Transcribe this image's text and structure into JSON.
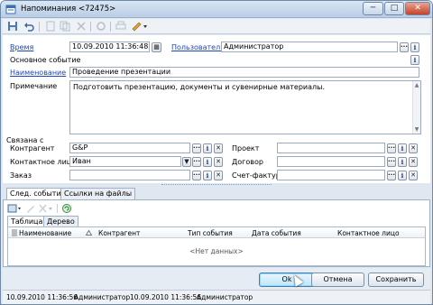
{
  "window": {
    "title": "Напоминания <72475>",
    "min": "─",
    "max": "□",
    "close": "✕"
  },
  "toolbar": {
    "icons": [
      "save-icon",
      "undo-icon",
      "new-icon",
      "copy-icon",
      "delete-icon",
      "refresh-icon",
      "print-icon",
      "actions-icon"
    ]
  },
  "form": {
    "time_label": "Время",
    "time_value": "10.09.2010 11:36:48",
    "user_label": "Пользователь",
    "user_value": "Администратор",
    "base_event_label": "Основное событие",
    "name_label": "Наименование",
    "name_value": "Проведение презентации",
    "note_label": "Примечание",
    "note_value": "Подготовить презентацию, документы и сувенирные материалы.",
    "linked_label": "Связана с",
    "counterparty_label": "Контрагент",
    "counterparty_value": "G&P",
    "contact_label": "Контактное лицо",
    "contact_value": "Иван",
    "order_label": "Заказ",
    "order_value": "",
    "project_label": "Проект",
    "project_value": "",
    "contract_label": "Договор",
    "contract_value": "",
    "invoice_label": "Счет-фактура",
    "invoice_value": ""
  },
  "tabs": [
    "След. события",
    "Ссылки на файлы"
  ],
  "subtabs": [
    "Таблица",
    "Дерево"
  ],
  "grid": {
    "columns": [
      "Наименование",
      "Контрагент",
      "Тип события",
      "Дата события",
      "Контактное лицо"
    ],
    "empty": "<Нет данных>"
  },
  "buttons": {
    "ok": "Ok",
    "cancel": "Отмена",
    "save": "Сохранить"
  },
  "status": {
    "created_date": "10.09.2010 11:36:56",
    "created_by": "Администратор",
    "modified_date": "10.09.2010 11:36:56",
    "modified_by": "Администратор"
  },
  "glyphs": {
    "ellipsis": "···",
    "info": "i",
    "clear": "✕",
    "dropdown": "▼",
    "calendar": "▦",
    "up": "▲",
    "down": "▼"
  }
}
